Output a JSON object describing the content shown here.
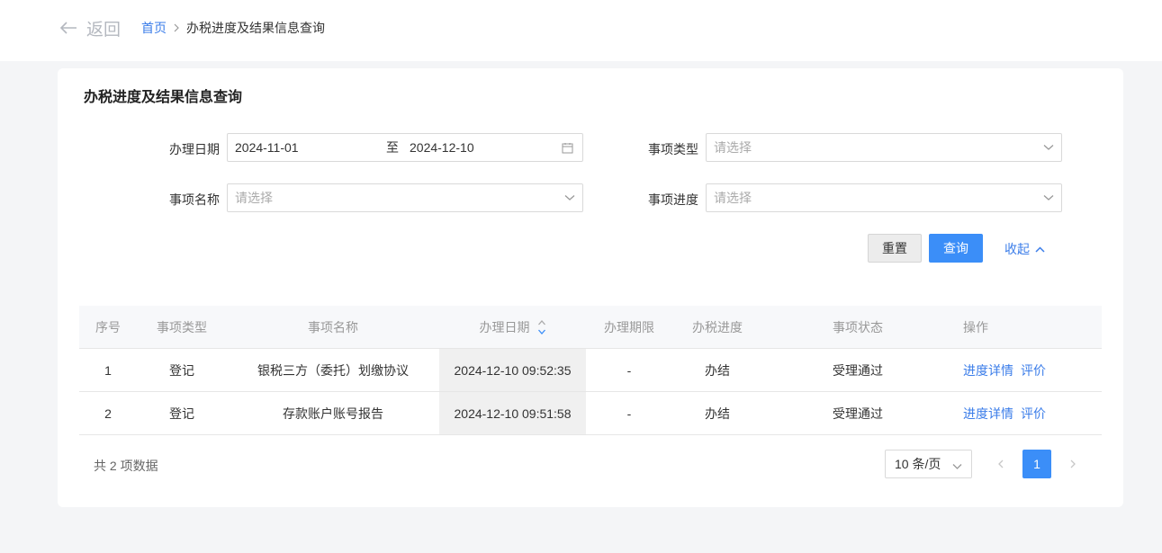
{
  "header": {
    "back_label": "返回",
    "breadcrumb": {
      "home": "首页",
      "current": "办税进度及结果信息查询"
    }
  },
  "card": {
    "title": "办税进度及结果信息查询"
  },
  "form": {
    "date_label": "办理日期",
    "date_start": "2024-11-01",
    "date_sep": "至",
    "date_end": "2024-12-10",
    "type_label": "事项类型",
    "type_placeholder": "请选择",
    "name_label": "事项名称",
    "name_placeholder": "请选择",
    "progress_label": "事项进度",
    "progress_placeholder": "请选择",
    "reset_label": "重置",
    "query_label": "查询",
    "collapse_label": "收起"
  },
  "table": {
    "columns": [
      "序号",
      "事项类型",
      "事项名称",
      "办理日期",
      "办理期限",
      "办税进度",
      "事项状态",
      "操作"
    ],
    "rows": [
      {
        "index": "1",
        "type": "登记",
        "name": "银税三方（委托）划缴协议",
        "date": "2024-12-10 09:52:35",
        "deadline": "-",
        "progress": "办结",
        "status": "受理通过",
        "op_detail": "进度详情",
        "op_rate": "评价"
      },
      {
        "index": "2",
        "type": "登记",
        "name": "存款账户账号报告",
        "date": "2024-12-10 09:51:58",
        "deadline": "-",
        "progress": "办结",
        "status": "受理通过",
        "op_detail": "进度详情",
        "op_rate": "评价"
      }
    ]
  },
  "pagination": {
    "total_text": "共 2 项数据",
    "page_size": "10 条/页",
    "current_page": "1"
  },
  "colors": {
    "primary": "#3b8ef8",
    "link": "#3b7de9",
    "page_bg": "#f4f5f7"
  }
}
